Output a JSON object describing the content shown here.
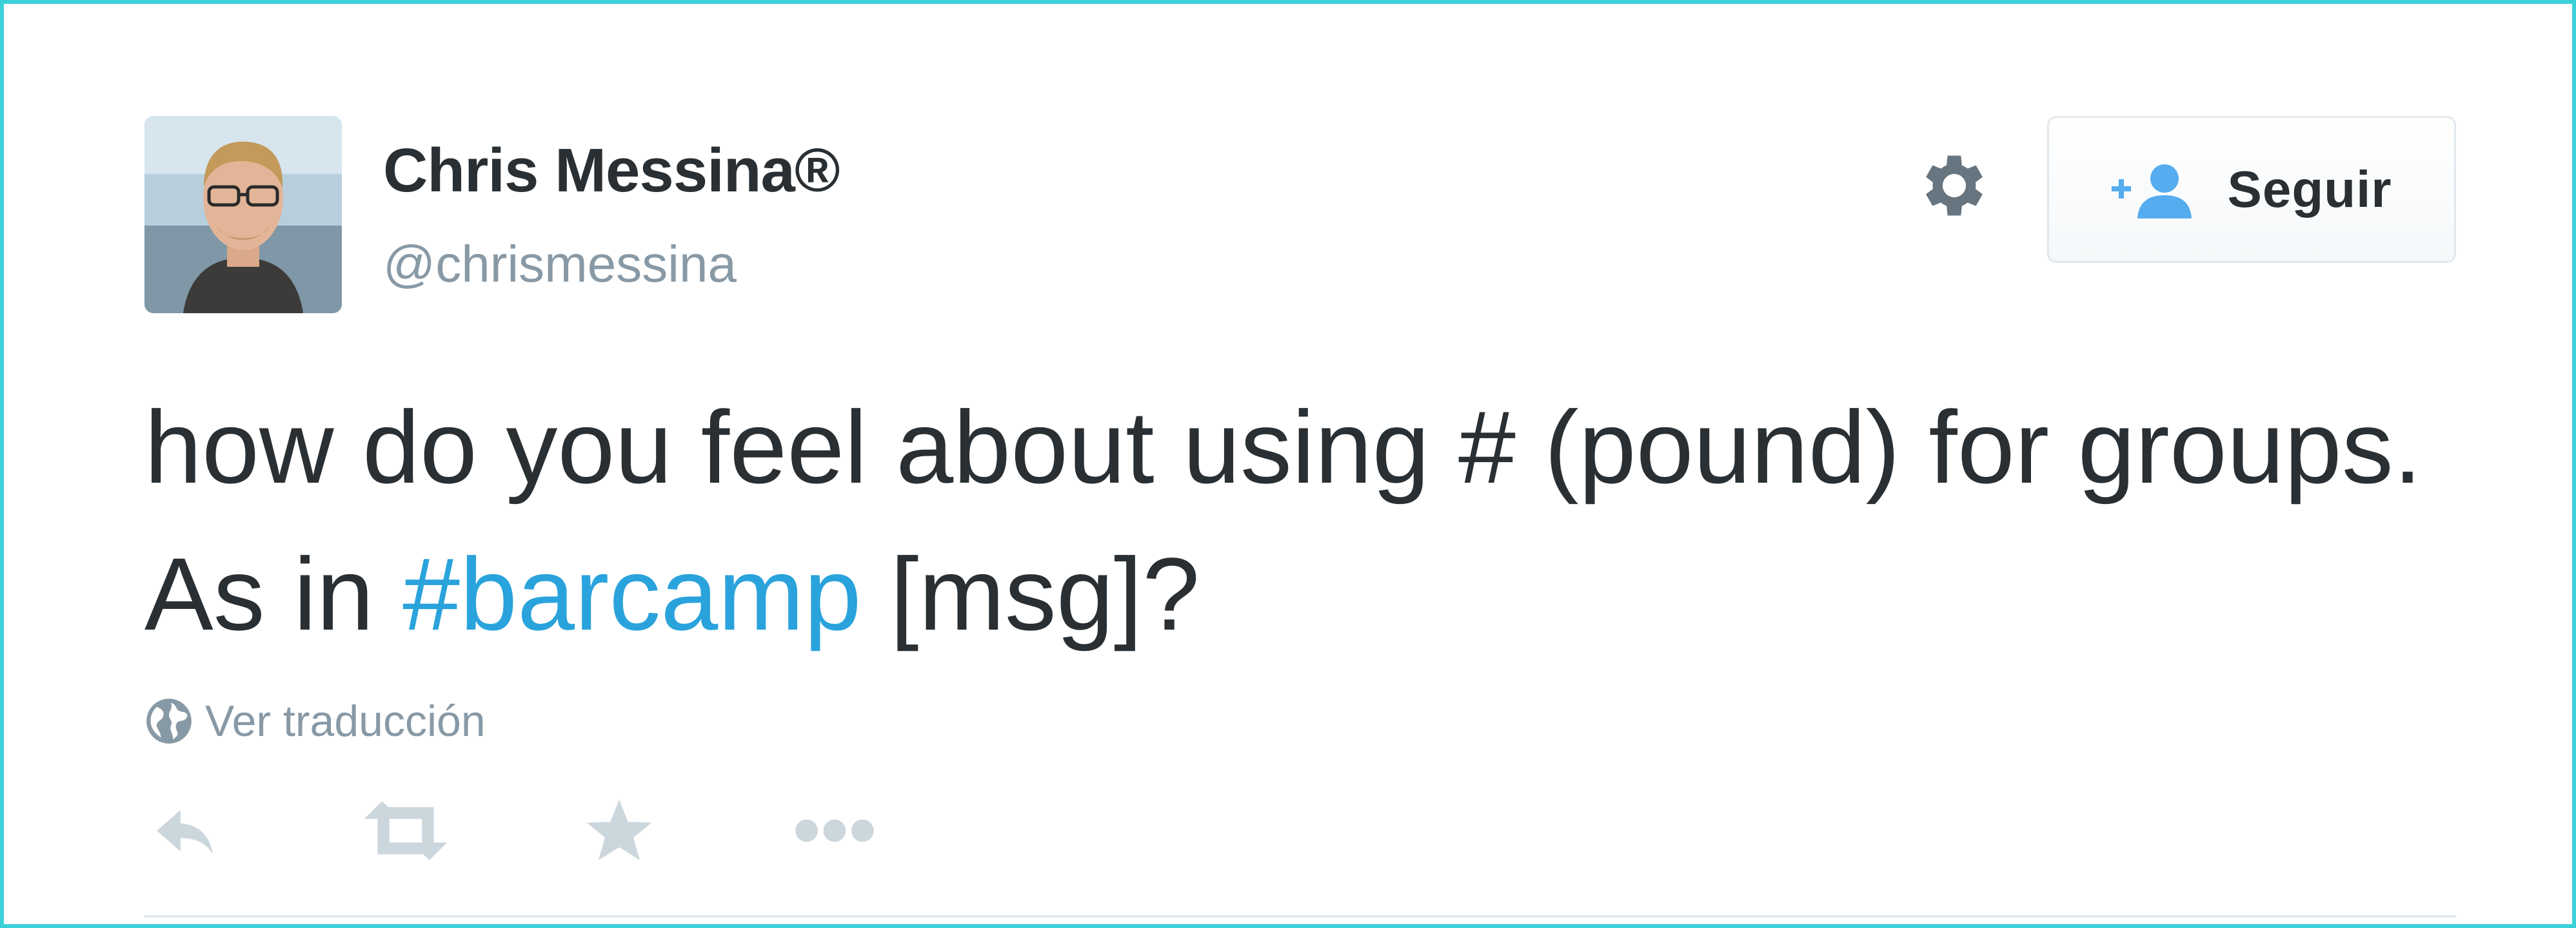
{
  "tweet": {
    "author": {
      "display_name": "Chris Messina®",
      "handle": "@chrismessina",
      "avatar_icon": "user-avatar-photo"
    },
    "text_parts": [
      "how do you feel about using # (pound) for groups. As in ",
      "#barcamp",
      " [msg]?"
    ],
    "hashtag_color": "#2aa3dc",
    "translate_label": "Ver traducción",
    "translate_icon": "globe-icon"
  },
  "toolbar": {
    "follow_label": "Seguir",
    "follow_icon": "add-user-icon",
    "settings_icon": "gear-icon"
  },
  "actions": [
    {
      "name": "reply",
      "icon": "reply-icon"
    },
    {
      "name": "retweet",
      "icon": "retweet-icon"
    },
    {
      "name": "favorite",
      "icon": "star-icon"
    },
    {
      "name": "more",
      "icon": "more-dots-icon"
    }
  ],
  "colors": {
    "text": "#292f33",
    "muted": "#8899a6",
    "icon_light": "#ccd6dd",
    "accent": "#55acee",
    "frame_border": "#3ed0d8"
  }
}
